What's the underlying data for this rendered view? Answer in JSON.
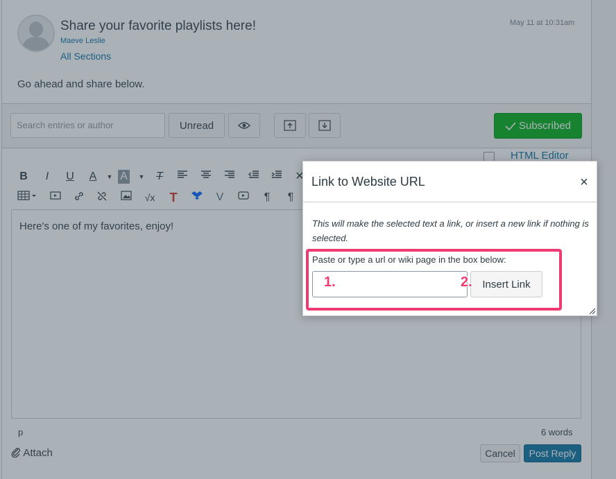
{
  "post": {
    "title": "Share your favorite playlists here!",
    "author": "Maeve Leslie",
    "sections": "All Sections",
    "date": "May 11 at 10:31am",
    "body": "Go ahead and share below."
  },
  "toolbar": {
    "search_placeholder": "Search entries or author",
    "unread_label": "Unread",
    "subscribed_label": "Subscribed"
  },
  "editor": {
    "html_editor_label": "HTML Editor",
    "content": "Here's one of my favorites, enjoy!",
    "status_path": "p",
    "word_count": "6 words",
    "attach_label": "Attach",
    "cancel_label": "Cancel",
    "post_reply_label": "Post Reply"
  },
  "rte_buttons": {
    "bold": "B",
    "italic": "I",
    "underline": "U",
    "text_color": "A",
    "bg_color": "A",
    "clear_format": "T",
    "close_partial": "✕",
    "paragraph": "¶",
    "paragraph_dir": "¶"
  },
  "dialog": {
    "title": "Link to Website URL",
    "close_glyph": "×",
    "description": "This will make the selected text a link, or insert a new link if nothing is selected.",
    "label": "Paste or type a url or wiki page in the box below:",
    "url_value": "",
    "insert_label": "Insert Link"
  },
  "annotations": {
    "step1": "1.",
    "step2": "2.",
    "color": "#ef3a72"
  },
  "colors": {
    "link": "#0770a3",
    "subscribed": "#00ac18",
    "primary": "#0770a3"
  }
}
